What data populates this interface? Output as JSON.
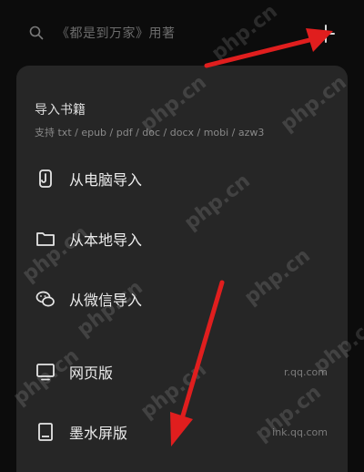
{
  "search": {
    "placeholder": "《都是到万家》用著",
    "icon": "search-icon"
  },
  "header": {
    "add_icon": "plus-icon"
  },
  "import_sheet": {
    "title": "导入书籍",
    "supported_formats": "支持 txt / epub / pdf / doc / docx / mobi / azw3",
    "items": [
      {
        "label": "从电脑导入",
        "icon": "usb-transfer-icon",
        "url": ""
      },
      {
        "label": "从本地导入",
        "icon": "folder-icon",
        "url": ""
      },
      {
        "label": "从微信导入",
        "icon": "wechat-icon",
        "url": ""
      },
      {
        "label": "网页版",
        "icon": "monitor-icon",
        "url": "r.qq.com"
      },
      {
        "label": "墨水屏版",
        "icon": "e-reader-icon",
        "url": "ink.qq.com"
      }
    ]
  },
  "watermark": {
    "text": "php.cn"
  },
  "colors": {
    "background": "#0c0c0c",
    "sheet": "#262626",
    "text_primary": "#ececec",
    "text_secondary": "#8a8a8a",
    "annotation_arrow": "#e01e1e"
  }
}
